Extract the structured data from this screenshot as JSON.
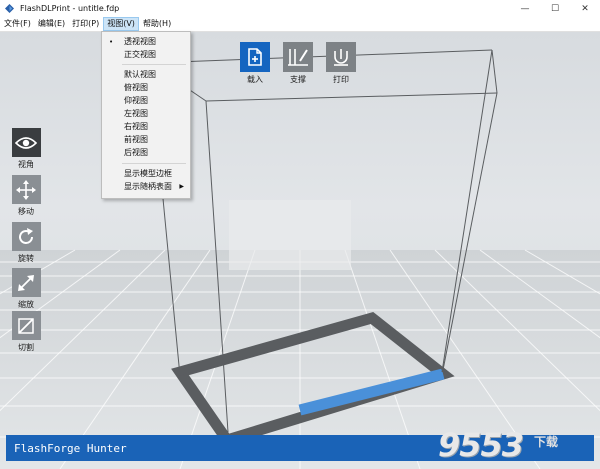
{
  "window": {
    "title": "FlashDLPrint - untitle.fdp",
    "controls": {
      "minimize": "—",
      "maximize": "☐",
      "close": "✕"
    }
  },
  "menubar": {
    "items": [
      "文件(F)",
      "编辑(E)",
      "打印(P)",
      "视图(V)",
      "帮助(H)"
    ],
    "active": "视图(V)"
  },
  "view_menu": {
    "items": [
      {
        "label": "透视视图",
        "checked": true
      },
      {
        "label": "正交视图"
      },
      {
        "label": "默认视图"
      },
      {
        "label": "俯视图"
      },
      {
        "label": "仰视图"
      },
      {
        "label": "左视图"
      },
      {
        "label": "右视图"
      },
      {
        "label": "前视图"
      },
      {
        "label": "后视图"
      },
      {
        "label": "显示模型边框"
      },
      {
        "label": "显示随柄表面",
        "submenu": true
      }
    ],
    "check_mark": "•",
    "submenu_arrow": "▶"
  },
  "top_toolbar": {
    "load": "载入",
    "support": "支撑",
    "print": "打印"
  },
  "side_toolbar": {
    "view": "视角",
    "move": "移动",
    "rotate": "旋转",
    "scale": "缩放",
    "cut": "切割"
  },
  "status": {
    "device": "FlashForge Hunter"
  },
  "watermark": {
    "text": "9553",
    "sub": "下载"
  },
  "colors": {
    "accent_blue": "#1565c0",
    "status_blue": "#1a63b7",
    "tool_gray": "#8a8f94",
    "tool_dark": "#3a3d40",
    "build_plate_frame": "#5a5d60",
    "build_plate_highlight": "#4a90d9"
  }
}
